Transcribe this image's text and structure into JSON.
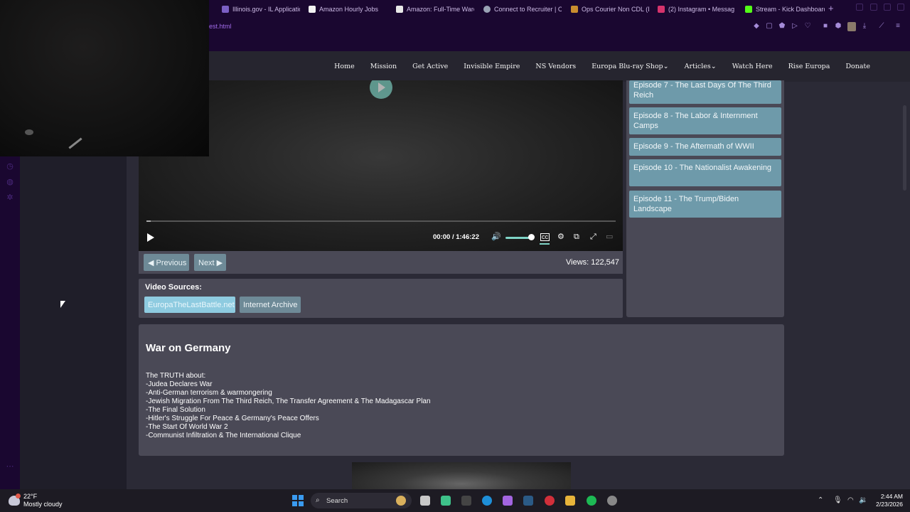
{
  "browser": {
    "tabs": [
      {
        "label": "Illinois.gov - IL Applicatio",
        "color": "#7b5fc4"
      },
      {
        "label": "Amazon Hourly Jobs",
        "color": "#f2f2f2"
      },
      {
        "label": "Amazon: Full-Time Ware",
        "color": "#1a0730"
      },
      {
        "label": "Connect to Recruiter | C",
        "color": "#9aa3b5"
      },
      {
        "label": "Ops Courier Non CDL (D",
        "color": "#c98d2e"
      },
      {
        "label": "(2) Instagram • Messag",
        "color": "#d6336c"
      },
      {
        "label": "Stream - Kick Dashboard",
        "color": "#53fc18"
      }
    ],
    "url_fragment": "est.html"
  },
  "site_nav": {
    "items": [
      "Home",
      "Mission",
      "Get Active",
      "Invisible Empire",
      "NS Vendors",
      "Europa Blu-ray Shop",
      "Articles",
      "Watch Here",
      "Rise Europa",
      "Donate"
    ]
  },
  "player": {
    "time_current": "00:00",
    "time_separator": "/",
    "time_total": "1:46:22",
    "volume_level": 0.9,
    "accent_color": "#7fd4c6"
  },
  "controls": {
    "previous_label": "◀ Previous",
    "next_label": "Next ▶",
    "views_text": "Views: 122,547"
  },
  "sources": {
    "title": "Video Sources:",
    "items": [
      "EuropaTheLastBattle.net",
      "Internet Archive"
    ]
  },
  "episodes": [
    "Episode 7 - The Last Days Of The Third Reich",
    "Episode 8 - The Labor & Internment Camps",
    "Episode 9 - The Aftermath of WWII",
    "Episode 10 - The Nationalist Awakening",
    "Episode 11 - The Trump/Biden Landscape"
  ],
  "description": {
    "title": "War on Germany",
    "lines": [
      "The TRUTH about:",
      "-Judea Declares War",
      "-Anti-German terrorism & warmongering",
      "-Jewish Migration From The Third Reich, The Transfer Agreement & The Madagascar Plan",
      "-The Final Solution",
      "-Hitler's Struggle For Peace & Germany's Peace Offers",
      "-The Start Of World War 2",
      "-Communist Infiltration & The International Clique"
    ]
  },
  "taskbar": {
    "temperature": "22°F",
    "weather": "Mostly cloudy",
    "search_placeholder": "Search",
    "time": "2:44 AM",
    "date": "2/23/2026"
  }
}
